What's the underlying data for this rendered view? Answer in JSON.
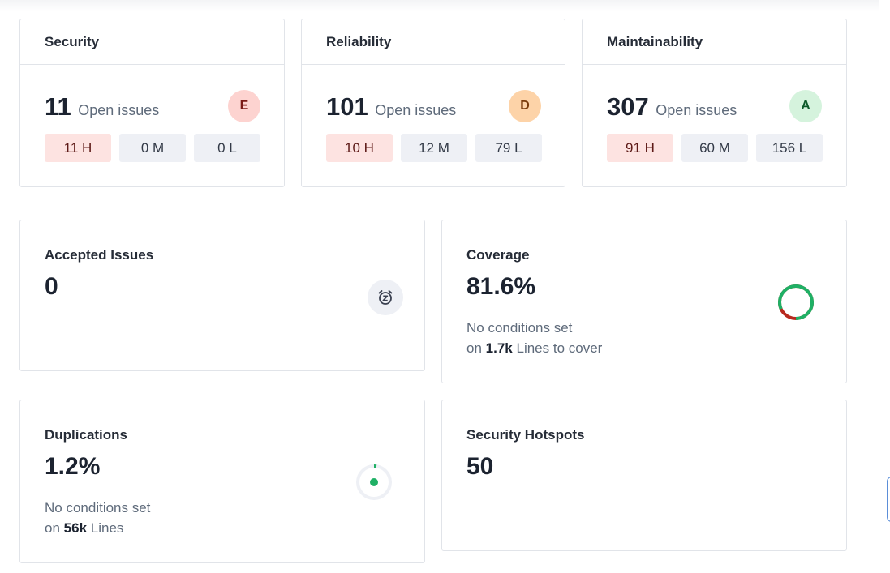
{
  "ratings": [
    {
      "title": "Security",
      "count": "11",
      "open_label": "Open issues",
      "grade": "E",
      "pills": [
        "11 H",
        "0 M",
        "0 L"
      ]
    },
    {
      "title": "Reliability",
      "count": "101",
      "open_label": "Open issues",
      "grade": "D",
      "pills": [
        "10 H",
        "12 M",
        "79 L"
      ]
    },
    {
      "title": "Maintainability",
      "count": "307",
      "open_label": "Open issues",
      "grade": "A",
      "pills": [
        "91 H",
        "60 M",
        "156 L"
      ]
    }
  ],
  "accepted": {
    "title": "Accepted Issues",
    "value": "0",
    "icon": "alarm-snooze-icon"
  },
  "coverage": {
    "title": "Coverage",
    "value": "81.6%",
    "conditions": "No conditions set",
    "on": "on",
    "lines_value": "1.7k",
    "lines_label": "Lines to cover",
    "percent": 81.6,
    "covered_color": "#1fb065",
    "uncovered_color": "#b8291e"
  },
  "duplications": {
    "title": "Duplications",
    "value": "1.2%",
    "conditions": "No conditions set",
    "on": "on",
    "lines_value": "56k",
    "lines_label": "Lines",
    "percent": 1.2,
    "color": "#1fb065"
  },
  "hotspots": {
    "title": "Security Hotspots",
    "value": "50"
  },
  "colors": {
    "high_pill": "#fde3e1",
    "neutral_pill": "#eef0f5",
    "border": "#e1e4e9"
  }
}
